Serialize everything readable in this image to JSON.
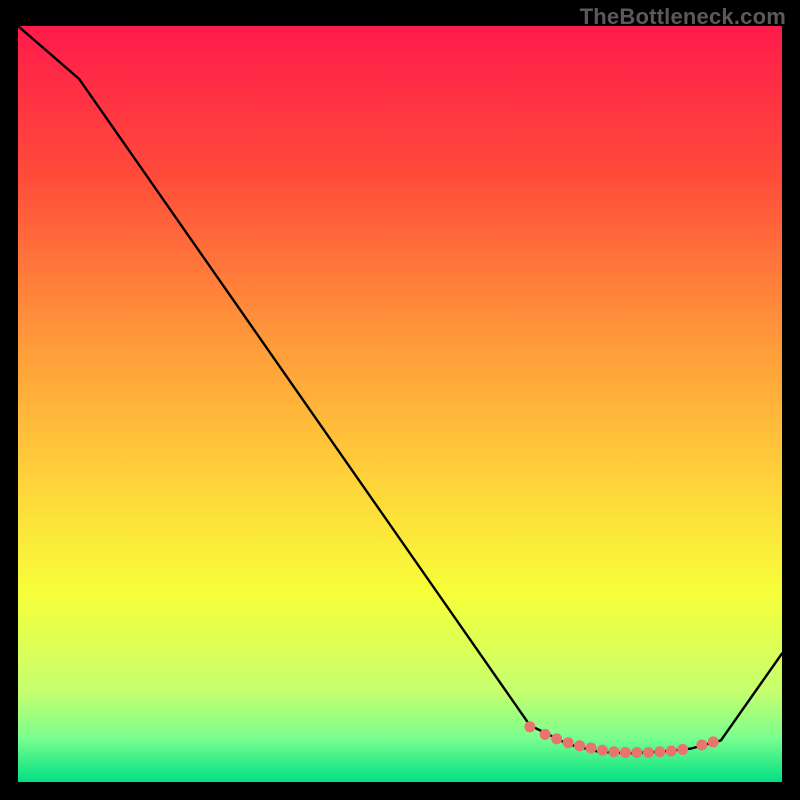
{
  "watermark": "TheBottleneck.com",
  "chart_data": {
    "type": "line",
    "title": "",
    "xlabel": "",
    "ylabel": "",
    "xlim": [
      0,
      100
    ],
    "ylim": [
      0,
      100
    ],
    "grid": false,
    "legend": false,
    "gradient_stops": [
      {
        "offset": 0.0,
        "color": "#ff1a4b"
      },
      {
        "offset": 0.2,
        "color": "#ff4c3a"
      },
      {
        "offset": 0.4,
        "color": "#ff943a"
      },
      {
        "offset": 0.6,
        "color": "#ffd23a"
      },
      {
        "offset": 0.75,
        "color": "#f7ff3a"
      },
      {
        "offset": 0.88,
        "color": "#c6ff6e"
      },
      {
        "offset": 0.94,
        "color": "#7dff8e"
      },
      {
        "offset": 1.0,
        "color": "#00e084"
      }
    ],
    "series": [
      {
        "name": "curve",
        "x": [
          0.0,
          4.0,
          8.0,
          67.0,
          72.0,
          76.0,
          80.0,
          84.0,
          88.0,
          92.0,
          100.0
        ],
        "y": [
          100.0,
          96.5,
          93.0,
          7.5,
          5.0,
          4.0,
          3.8,
          4.0,
          4.4,
          5.5,
          17.0
        ]
      }
    ],
    "scatter_points": {
      "name": "dots",
      "color": "#e9746f",
      "x": [
        67.0,
        69.0,
        70.5,
        72.0,
        73.5,
        75.0,
        76.5,
        78.0,
        79.5,
        81.0,
        82.5,
        84.0,
        85.5,
        87.0,
        89.5,
        91.0
      ],
      "y": [
        7.3,
        6.3,
        5.7,
        5.2,
        4.8,
        4.5,
        4.2,
        4.0,
        3.9,
        3.9,
        3.9,
        4.0,
        4.1,
        4.3,
        4.9,
        5.3
      ]
    }
  }
}
